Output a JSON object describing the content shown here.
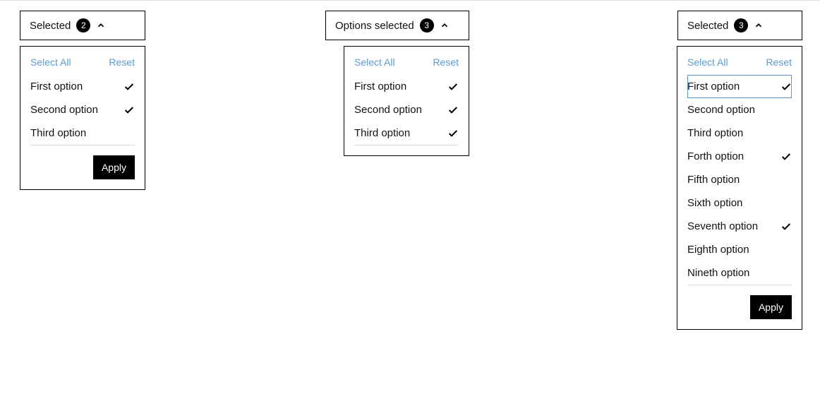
{
  "common": {
    "select_all": "Select All",
    "reset": "Reset",
    "apply": "Apply"
  },
  "dropdowns": [
    {
      "id": "dd1",
      "header_label": "Selected",
      "count": "2",
      "has_apply": true,
      "options": [
        {
          "label": "First option",
          "checked": true,
          "highlight": false
        },
        {
          "label": "Second option",
          "checked": true,
          "highlight": false
        },
        {
          "label": "Third option",
          "checked": false,
          "highlight": false
        }
      ]
    },
    {
      "id": "dd2",
      "header_label": "Options selected",
      "count": "3",
      "has_apply": false,
      "options": [
        {
          "label": "First option",
          "checked": true,
          "highlight": false
        },
        {
          "label": "Second option",
          "checked": true,
          "highlight": false
        },
        {
          "label": "Third option",
          "checked": true,
          "highlight": false
        }
      ]
    },
    {
      "id": "dd3",
      "header_label": "Selected",
      "count": "3",
      "has_apply": true,
      "options": [
        {
          "label": "First option",
          "checked": true,
          "highlight": true
        },
        {
          "label": "Second option",
          "checked": false,
          "highlight": false
        },
        {
          "label": "Third option",
          "checked": false,
          "highlight": false
        },
        {
          "label": "Forth option",
          "checked": true,
          "highlight": false
        },
        {
          "label": "Fifth option",
          "checked": false,
          "highlight": false
        },
        {
          "label": "Sixth option",
          "checked": false,
          "highlight": false
        },
        {
          "label": "Seventh option",
          "checked": true,
          "highlight": false
        },
        {
          "label": "Eighth option",
          "checked": false,
          "highlight": false
        },
        {
          "label": "Nineth option",
          "checked": false,
          "highlight": false
        }
      ]
    }
  ]
}
